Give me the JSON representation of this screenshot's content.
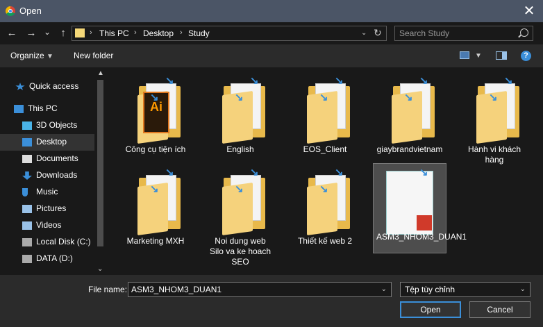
{
  "window": {
    "title": "Open",
    "close_glyph": "✕"
  },
  "nav": {
    "back_glyph": "←",
    "forward_glyph": "→",
    "recent_glyph": "⌄",
    "up_glyph": "↑",
    "breadcrumb": [
      "This PC",
      "Desktop",
      "Study"
    ],
    "refresh_glyph": "↻",
    "search_placeholder": "Search Study"
  },
  "toolbar": {
    "organize_label": "Organize",
    "new_folder_label": "New folder",
    "help_glyph": "?"
  },
  "sidebar": {
    "items": [
      {
        "label": "Quick access",
        "icon": "star-icon",
        "color": "#3b8fd9"
      },
      {
        "label": "This PC",
        "icon": "computer-icon",
        "color": "#3b8fd9"
      },
      {
        "label": "3D Objects",
        "icon": "cube-icon",
        "color": "#4ab4e8"
      },
      {
        "label": "Desktop",
        "icon": "desktop-icon",
        "color": "#3b8fd9",
        "selected": true
      },
      {
        "label": "Documents",
        "icon": "document-icon",
        "color": "#dddddd"
      },
      {
        "label": "Downloads",
        "icon": "download-icon",
        "color": "#3b8fd9"
      },
      {
        "label": "Music",
        "icon": "music-icon",
        "color": "#3b8fd9"
      },
      {
        "label": "Pictures",
        "icon": "pictures-icon",
        "color": "#9ac2e8"
      },
      {
        "label": "Videos",
        "icon": "videos-icon",
        "color": "#9ac2e8"
      },
      {
        "label": "Local Disk (C:)",
        "icon": "drive-icon",
        "color": "#aaaaaa"
      },
      {
        "label": "DATA (D:)",
        "icon": "drive-icon",
        "color": "#aaaaaa"
      }
    ]
  },
  "files": [
    {
      "name": "Công cụ tiện ích",
      "kind": "folder",
      "overlay": "Ai"
    },
    {
      "name": "English",
      "kind": "folder",
      "overlay": ""
    },
    {
      "name": "EOS_Client",
      "kind": "folder",
      "overlay": ""
    },
    {
      "name": "giaybrandvietnam",
      "kind": "folder",
      "overlay": ""
    },
    {
      "name": "Hành vi khách hàng",
      "kind": "folder",
      "overlay": ""
    },
    {
      "name": "Marketing MXH",
      "kind": "folder",
      "overlay": ""
    },
    {
      "name": "Noi dung web Silo va ke hoach SEO",
      "kind": "folder",
      "overlay": ""
    },
    {
      "name": "Thiết kế web 2",
      "kind": "folder",
      "overlay": ""
    },
    {
      "name": "ASM3_NHOM3_DUAN1",
      "kind": "pdf",
      "overlay": "",
      "selected": true
    }
  ],
  "bottom": {
    "file_name_label": "File name:",
    "file_name_value": "ASM3_NHOM3_DUAN1",
    "filter_value": "Tệp tùy chỉnh",
    "open_label": "Open",
    "cancel_label": "Cancel"
  },
  "colors": {
    "accent": "#3b8fd9",
    "folder": "#e8b94b",
    "titlebar": "#4b5566"
  }
}
